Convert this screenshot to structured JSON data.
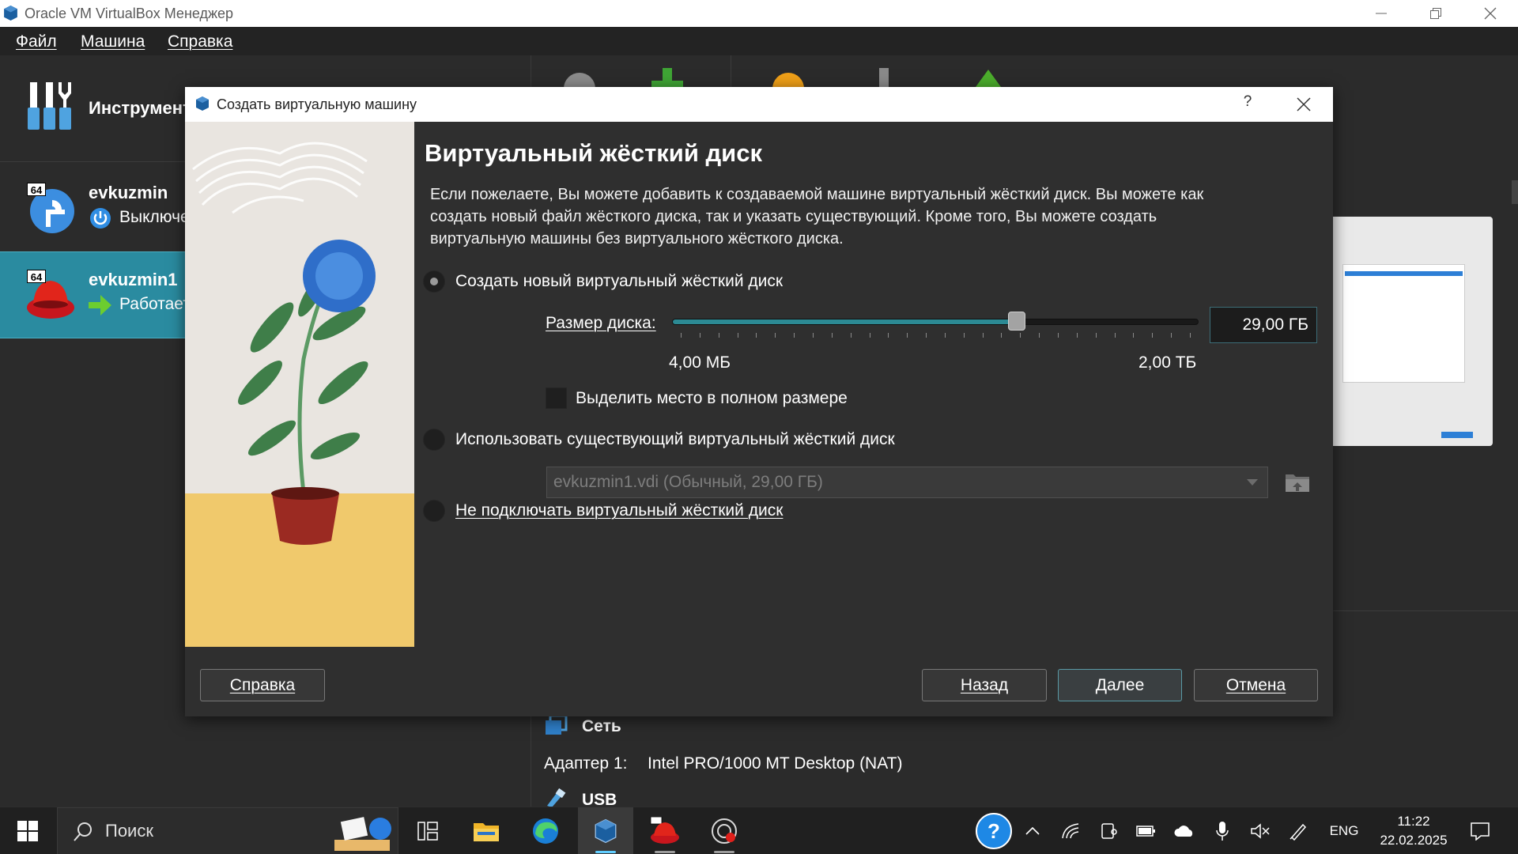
{
  "window": {
    "title": "Oracle VM VirtualBox Менеджер"
  },
  "menu": [
    "Файл",
    "Машина",
    "Справка"
  ],
  "tools": {
    "label": "Инструменты"
  },
  "vms": [
    {
      "name": "evkuzmin",
      "state": "Выключена"
    },
    {
      "name": "evkuzmin1",
      "state": "Работает"
    }
  ],
  "details": {
    "network_heading": "Сеть",
    "adapter_label": "Адаптер 1:",
    "adapter_value": "Intel PRO/1000 MT Desktop (NAT)",
    "usb_heading": "USB"
  },
  "dialog": {
    "title": "Создать виртуальную машину",
    "help_glyph": "?",
    "heading": "Виртуальный жёсткий диск",
    "description": "Если пожелаете, Вы можете добавить к создаваемой машине виртуальный жёсткий диск. Вы можете как создать новый файл жёсткого диска, так и указать существующий. Кроме того, Вы можете создать виртуальную машины без виртуального жёсткого диска.",
    "option_create": "Создать новый виртуальный жёсткий диск",
    "size_label": "Размер диска:",
    "disk_size": "29,00 ГБ",
    "slider_fraction": 0.66,
    "range_min": "4,00 МБ",
    "range_max": "2,00 ТБ",
    "preallocate_label": "Выделить место в полном размере",
    "option_existing": "Использовать существующий виртуальный жёсткий диск",
    "existing_disk": "evkuzmin1.vdi (Обычный, 29,00 ГБ)",
    "option_none": "Не подключать виртуальный жёсткий диск",
    "buttons": {
      "help": "Справка",
      "back": "Назад",
      "next": "Далее",
      "cancel": "Отмена"
    }
  },
  "taskbar": {
    "search_label": "Поиск",
    "lang": "ENG",
    "time": "11:22",
    "date": "22.02.2025"
  }
}
